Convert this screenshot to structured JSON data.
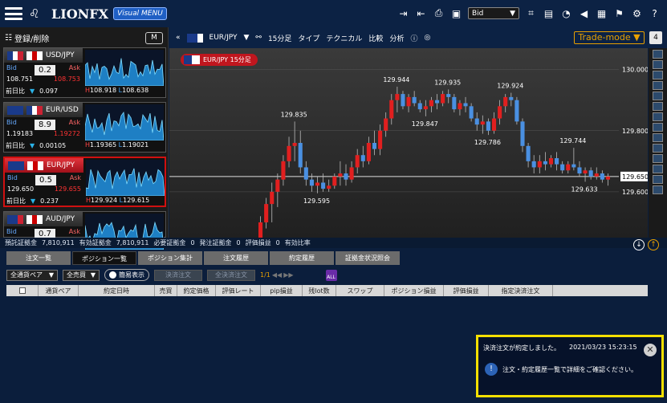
{
  "app": {
    "logo": "LIONFX",
    "visual_menu": "Visual MENU",
    "bid_select": "Bid"
  },
  "left": {
    "register": "登録/削除",
    "m_button": "M",
    "pairs": [
      {
        "name": "USD/JPY",
        "bid_label": "Bid",
        "ask_label": "Ask",
        "spread": "0.2",
        "bid": "108.751",
        "ask": "108.753",
        "change_label": "前日比",
        "change": "0.097",
        "high": "108.918",
        "low": "108.638",
        "flag": [
          "#1a3a8a",
          "#ffffff",
          "#cc2233"
        ],
        "flag2": [
          "#ffffff",
          "#cc0000",
          "#ffffff"
        ]
      },
      {
        "name": "EUR/USD",
        "bid_label": "Bid",
        "ask_label": "Ask",
        "spread": "8.9",
        "bid": "1.19183",
        "ask": "1.19272",
        "change_label": "前日比",
        "change": "0.00105",
        "high": "1.19365",
        "low": "1.19021",
        "flag": [
          "#1a3a8a",
          "#1a3a8a",
          "#1a3a8a"
        ],
        "flag2": [
          "#1a3a8a",
          "#ffffff",
          "#cc2233"
        ]
      },
      {
        "name": "EUR/JPY",
        "bid_label": "Bid",
        "ask_label": "Ask",
        "spread": "0.5",
        "bid": "129.650",
        "ask": "129.655",
        "change_label": "前日比",
        "change": "0.237",
        "high": "129.924",
        "low": "129.615",
        "flag": [
          "#1a3a8a",
          "#1a3a8a",
          "#1a3a8a"
        ],
        "flag2": [
          "#ffffff",
          "#cc0000",
          "#ffffff"
        ]
      },
      {
        "name": "AUD/JPY",
        "bid_label": "Bid",
        "ask_label": "Ask",
        "spread": "0.7",
        "bid": "",
        "ask": "",
        "change_label": "",
        "change": "",
        "high": "",
        "low": "",
        "flag": [
          "#1a3a8a",
          "#1a3a8a",
          "#cc2233"
        ],
        "flag2": [
          "#ffffff",
          "#cc0000",
          "#ffffff"
        ]
      }
    ]
  },
  "toolbar": {
    "pair": "EUR/JPY",
    "timeframe": "15分足",
    "type": "タイプ",
    "technical": "テクニカル",
    "compare": "比較",
    "analysis": "分析",
    "trade_mode": "Trade-mode",
    "count": "4"
  },
  "chart": {
    "tag": "EUR/JPY 15分足",
    "yaxis": [
      "130.000",
      "129.800",
      "129.650",
      "129.600"
    ],
    "annotations": [
      "129.944",
      "129.935",
      "129.924",
      "129.835",
      "129.847",
      "129.786",
      "129.744",
      "129.595",
      "129.633"
    ]
  },
  "chart_data": {
    "type": "candlestick",
    "title": "EUR/JPY 15分足",
    "ylim": [
      129.45,
      130.07
    ],
    "candles": [
      [
        129.45,
        129.52,
        129.4,
        129.5
      ],
      [
        129.5,
        129.58,
        129.48,
        129.56
      ],
      [
        129.56,
        129.63,
        129.5,
        129.6
      ],
      [
        129.6,
        129.66,
        129.55,
        129.64
      ],
      [
        129.64,
        129.72,
        129.62,
        129.7
      ],
      [
        129.7,
        129.78,
        129.68,
        129.75
      ],
      [
        129.75,
        129.83,
        129.7,
        129.76
      ],
      [
        129.76,
        129.8,
        129.66,
        129.68
      ],
      [
        129.68,
        129.7,
        129.62,
        129.64
      ],
      [
        129.64,
        129.66,
        129.6,
        129.62
      ],
      [
        129.62,
        129.65,
        129.595,
        129.63
      ],
      [
        129.63,
        129.66,
        129.6,
        129.61
      ],
      [
        129.61,
        129.64,
        129.6,
        129.62
      ],
      [
        129.62,
        129.66,
        129.61,
        129.65
      ],
      [
        129.65,
        129.7,
        129.62,
        129.66
      ],
      [
        129.66,
        129.69,
        129.62,
        129.64
      ],
      [
        129.64,
        129.7,
        129.63,
        129.68
      ],
      [
        129.68,
        129.74,
        129.66,
        129.72
      ],
      [
        129.72,
        129.75,
        129.68,
        129.7
      ],
      [
        129.7,
        129.78,
        129.69,
        129.76
      ],
      [
        129.76,
        129.8,
        129.72,
        129.74
      ],
      [
        129.74,
        129.82,
        129.72,
        129.8
      ],
      [
        129.8,
        129.86,
        129.78,
        129.84
      ],
      [
        129.84,
        129.92,
        129.82,
        129.9
      ],
      [
        129.9,
        129.944,
        129.86,
        129.92
      ],
      [
        129.92,
        129.93,
        129.87,
        129.88
      ],
      [
        129.88,
        129.92,
        129.86,
        129.91
      ],
      [
        129.91,
        129.93,
        129.88,
        129.89
      ],
      [
        129.89,
        129.9,
        129.86,
        129.87
      ],
      [
        129.87,
        129.9,
        129.847,
        129.88
      ],
      [
        129.88,
        129.91,
        129.86,
        129.9
      ],
      [
        129.9,
        129.92,
        129.87,
        129.89
      ],
      [
        129.89,
        129.93,
        129.88,
        129.92
      ],
      [
        129.92,
        129.935,
        129.89,
        129.91
      ],
      [
        129.91,
        129.92,
        129.86,
        129.87
      ],
      [
        129.87,
        129.9,
        129.85,
        129.89
      ],
      [
        129.89,
        129.91,
        129.86,
        129.88
      ],
      [
        129.88,
        129.89,
        129.83,
        129.84
      ],
      [
        129.84,
        129.86,
        129.8,
        129.82
      ],
      [
        129.82,
        129.85,
        129.79,
        129.83
      ],
      [
        129.83,
        129.84,
        129.786,
        129.8
      ],
      [
        129.8,
        129.86,
        129.79,
        129.84
      ],
      [
        129.84,
        129.9,
        129.82,
        129.88
      ],
      [
        129.88,
        129.92,
        129.86,
        129.91
      ],
      [
        129.91,
        129.924,
        129.88,
        129.9
      ],
      [
        129.9,
        129.91,
        129.82,
        129.83
      ],
      [
        129.83,
        129.84,
        129.73,
        129.75
      ],
      [
        129.75,
        129.76,
        129.68,
        129.7
      ],
      [
        129.7,
        129.72,
        129.66,
        129.68
      ],
      [
        129.68,
        129.72,
        129.66,
        129.7
      ],
      [
        129.7,
        129.73,
        129.67,
        129.69
      ],
      [
        129.69,
        129.72,
        129.68,
        129.71
      ],
      [
        129.71,
        129.73,
        129.67,
        129.69
      ],
      [
        129.69,
        129.7,
        129.66,
        129.67
      ],
      [
        129.67,
        129.7,
        129.66,
        129.69
      ],
      [
        129.69,
        129.744,
        129.67,
        129.68
      ],
      [
        129.68,
        129.7,
        129.65,
        129.66
      ],
      [
        129.66,
        129.68,
        129.633,
        129.67
      ],
      [
        129.67,
        129.68,
        129.64,
        129.65
      ],
      [
        129.65,
        129.68,
        129.64,
        129.66
      ],
      [
        129.66,
        129.67,
        129.63,
        129.64
      ],
      [
        129.64,
        129.66,
        129.62,
        129.65
      ]
    ]
  },
  "status": {
    "items": [
      "預託証拠金",
      "7,810,911",
      "有効証拠金",
      "7,810,911",
      "必要証拠金",
      "0",
      "発注証拠金",
      "0",
      "評価損益",
      "0",
      "有効比率"
    ]
  },
  "tabs": [
    "注文一覧",
    "ポジション一覧",
    "ポジション集計",
    "注文履歴",
    "約定履歴",
    "証拠金状況照会"
  ],
  "controls": {
    "pair_dd": "全通貨ペア",
    "side_dd": "全売買",
    "toggle": "簡易表示",
    "settle_btn": "決済注文",
    "all_settle_btn": "全決済注文",
    "page": "1/1"
  },
  "table_headers": [
    "",
    "通貨ペア",
    "約定日時",
    "売買",
    "約定価格",
    "評価レート",
    "pip損益",
    "残lot数",
    "スワップ",
    "ポジション損益",
    "評価損益",
    "指定決済注文"
  ],
  "toast": {
    "title": "決済注文が約定しました。",
    "time": "2021/03/23 15:23:15",
    "message": "注文・約定履歴一覧で詳細をご確認ください。"
  }
}
